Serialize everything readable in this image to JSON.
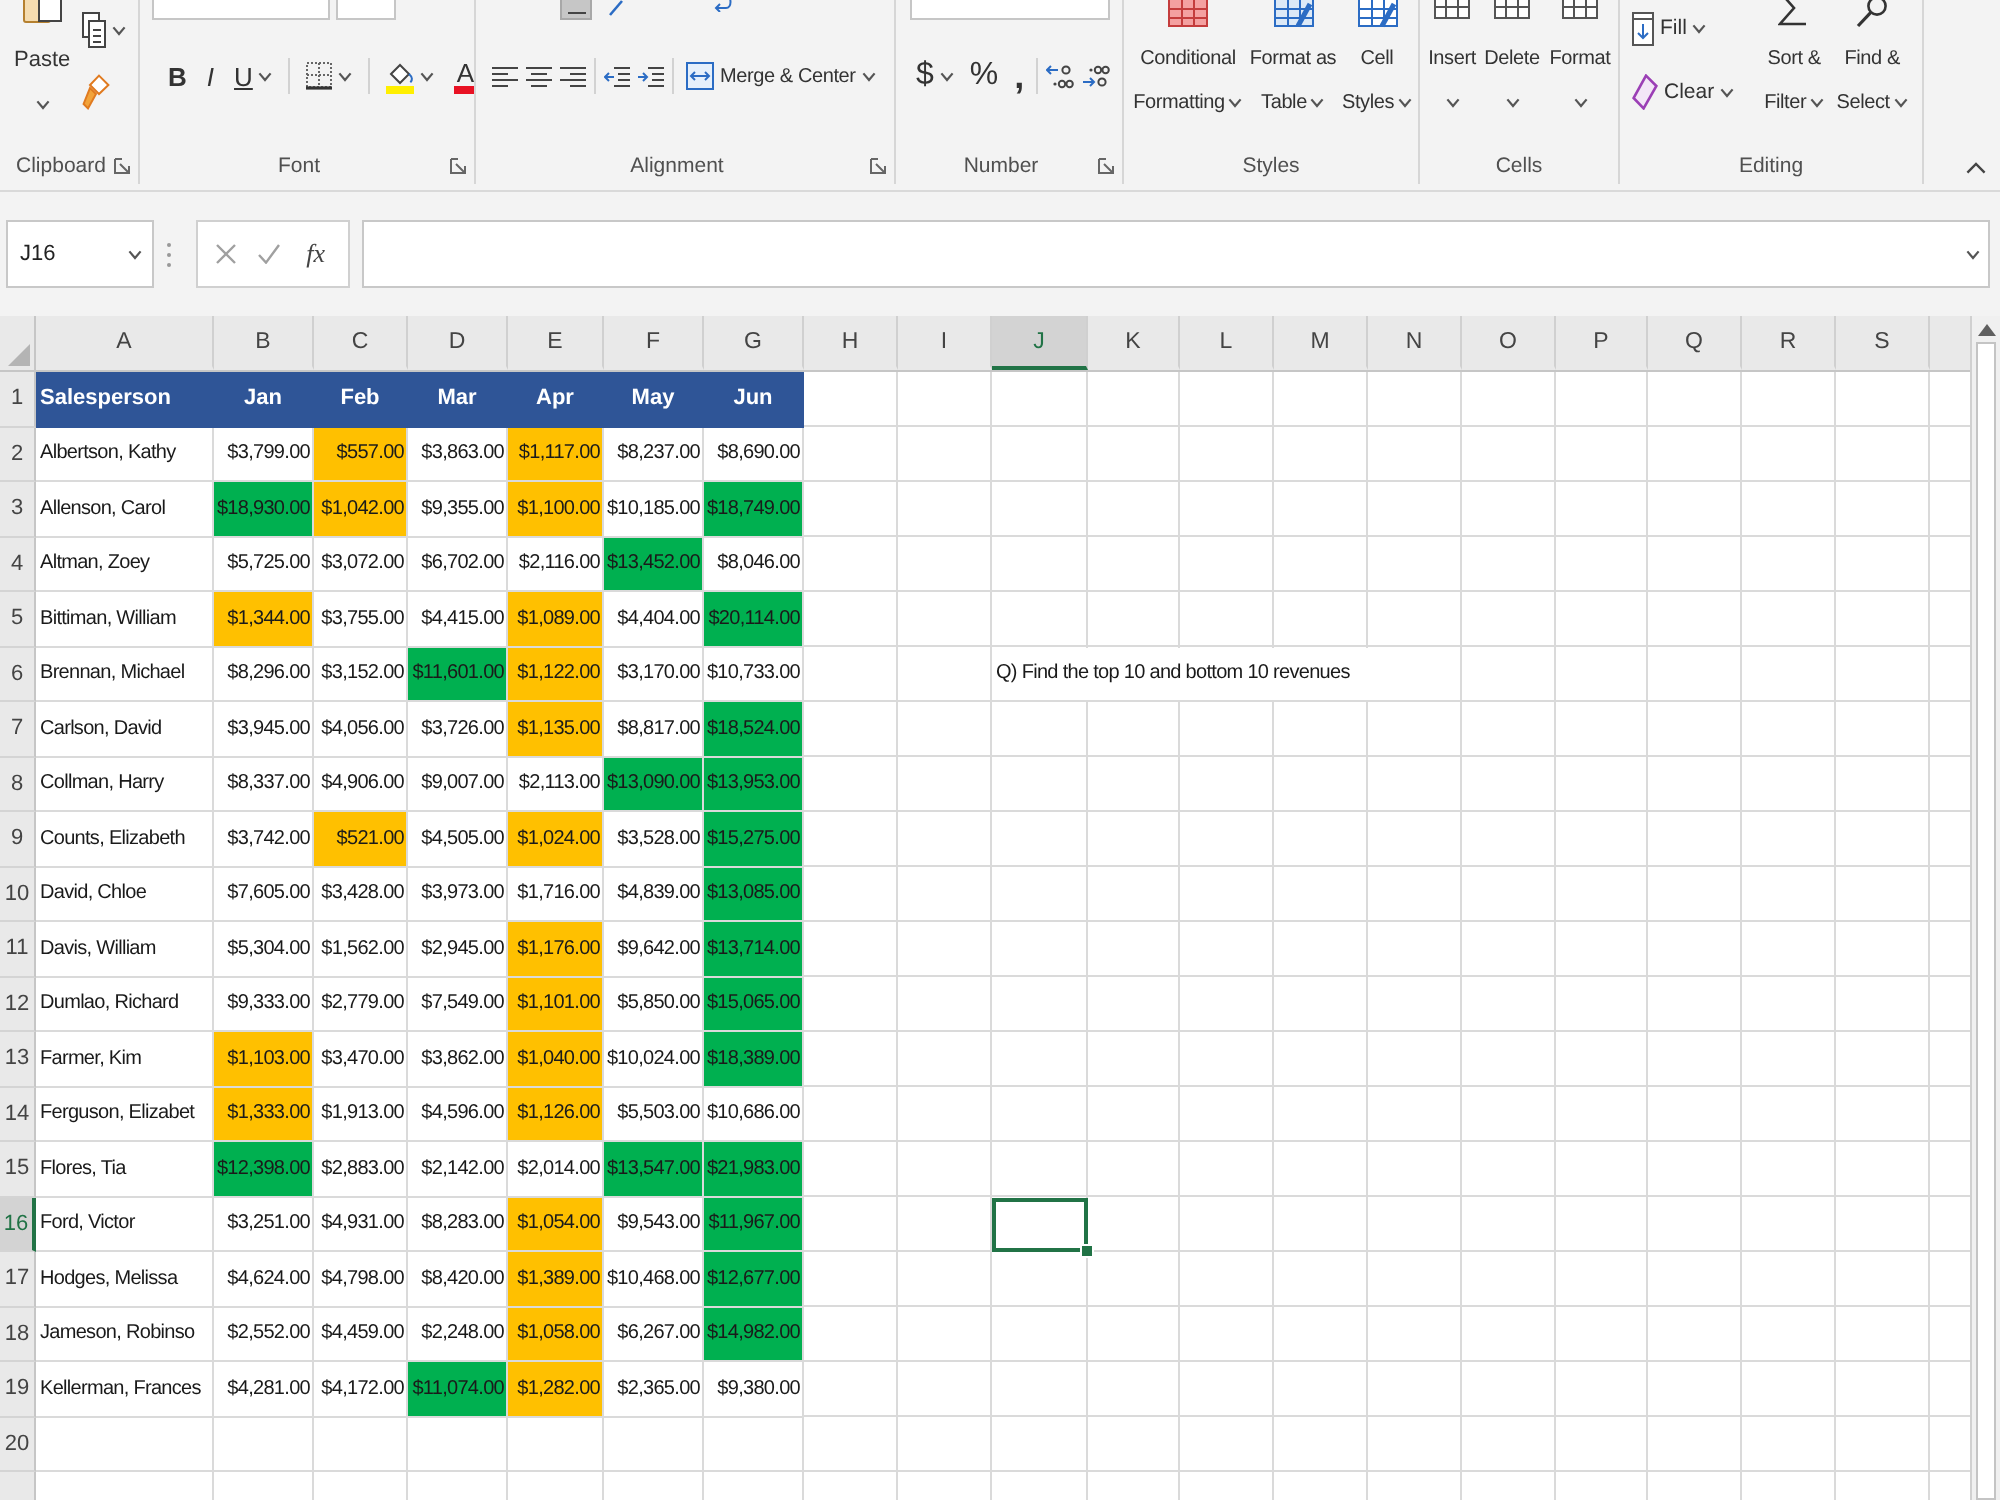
{
  "ribbon": {
    "groups": [
      {
        "kind": "clipboard",
        "label": "Clipboard",
        "launcher": true,
        "paste": "Paste"
      },
      {
        "kind": "font",
        "label": "Font",
        "launcher": true,
        "bold": "B",
        "italic": "I",
        "underline": "U",
        "font_color": "A"
      },
      {
        "kind": "alignment",
        "label": "Alignment",
        "launcher": true,
        "middle_align_selected": true,
        "merge": "Merge & Center"
      },
      {
        "kind": "number",
        "label": "Number",
        "launcher": true,
        "currency": "$",
        "percent": "%",
        "comma": ","
      },
      {
        "kind": "styles",
        "label": "Styles",
        "launcher": false,
        "buttons": [
          "Conditional Formatting",
          "Format as Table",
          "Cell Styles"
        ]
      },
      {
        "kind": "cells",
        "label": "Cells",
        "launcher": false,
        "buttons": [
          "Insert",
          "Delete",
          "Format"
        ]
      },
      {
        "kind": "editing",
        "label": "Editing",
        "launcher": false,
        "fill": "Fill",
        "clear": "Clear",
        "buttons": [
          "Sort & Filter",
          "Find & Select"
        ]
      }
    ]
  },
  "formula_bar": {
    "name_box": "J16",
    "function_button": "fx"
  },
  "sheet": {
    "columns": [
      {
        "label": "A",
        "selected": false
      },
      {
        "label": "B",
        "selected": false
      },
      {
        "label": "C",
        "selected": false
      },
      {
        "label": "D",
        "selected": false
      },
      {
        "label": "E",
        "selected": false
      },
      {
        "label": "F",
        "selected": false
      },
      {
        "label": "G",
        "selected": false
      },
      {
        "label": "H",
        "selected": false
      },
      {
        "label": "I",
        "selected": false
      },
      {
        "label": "J",
        "selected": true
      },
      {
        "label": "K",
        "selected": false
      },
      {
        "label": "L",
        "selected": false
      },
      {
        "label": "M",
        "selected": false
      },
      {
        "label": "N",
        "selected": false
      },
      {
        "label": "O",
        "selected": false
      },
      {
        "label": "P",
        "selected": false
      },
      {
        "label": "Q",
        "selected": false
      },
      {
        "label": "R",
        "selected": false
      },
      {
        "label": "S",
        "selected": false
      }
    ],
    "rows": [
      {
        "label": "1",
        "selected": false
      },
      {
        "label": "2",
        "selected": false
      },
      {
        "label": "3",
        "selected": false
      },
      {
        "label": "4",
        "selected": false
      },
      {
        "label": "5",
        "selected": false
      },
      {
        "label": "6",
        "selected": false
      },
      {
        "label": "7",
        "selected": false
      },
      {
        "label": "8",
        "selected": false
      },
      {
        "label": "9",
        "selected": false
      },
      {
        "label": "10",
        "selected": false
      },
      {
        "label": "11",
        "selected": false
      },
      {
        "label": "12",
        "selected": false
      },
      {
        "label": "13",
        "selected": false
      },
      {
        "label": "14",
        "selected": false
      },
      {
        "label": "15",
        "selected": false
      },
      {
        "label": "16",
        "selected": true
      },
      {
        "label": "17",
        "selected": false
      },
      {
        "label": "18",
        "selected": false
      },
      {
        "label": "19",
        "selected": false
      },
      {
        "label": "20",
        "selected": false
      }
    ],
    "header_row": [
      "Salesperson",
      "Jan",
      "Feb",
      "Mar",
      "Apr",
      "May",
      "Jun"
    ],
    "records": [
      {
        "name": "Albertson, Kathy",
        "cells": [
          {
            "value": "$3,799.00",
            "color": "#ffffff"
          },
          {
            "value": "$557.00",
            "color": "#ffc000"
          },
          {
            "value": "$3,863.00",
            "color": "#ffffff"
          },
          {
            "value": "$1,117.00",
            "color": "#ffc000"
          },
          {
            "value": "$8,237.00",
            "color": "#ffffff"
          },
          {
            "value": "$8,690.00",
            "color": "#ffffff"
          }
        ]
      },
      {
        "name": "Allenson, Carol",
        "cells": [
          {
            "value": "$18,930.00",
            "color": "#00b050"
          },
          {
            "value": "$1,042.00",
            "color": "#ffc000"
          },
          {
            "value": "$9,355.00",
            "color": "#ffffff"
          },
          {
            "value": "$1,100.00",
            "color": "#ffc000"
          },
          {
            "value": "$10,185.00",
            "color": "#ffffff"
          },
          {
            "value": "$18,749.00",
            "color": "#00b050"
          }
        ]
      },
      {
        "name": "Altman, Zoey",
        "cells": [
          {
            "value": "$5,725.00",
            "color": "#ffffff"
          },
          {
            "value": "$3,072.00",
            "color": "#ffffff"
          },
          {
            "value": "$6,702.00",
            "color": "#ffffff"
          },
          {
            "value": "$2,116.00",
            "color": "#ffffff"
          },
          {
            "value": "$13,452.00",
            "color": "#00b050"
          },
          {
            "value": "$8,046.00",
            "color": "#ffffff"
          }
        ]
      },
      {
        "name": "Bittiman, William",
        "cells": [
          {
            "value": "$1,344.00",
            "color": "#ffc000"
          },
          {
            "value": "$3,755.00",
            "color": "#ffffff"
          },
          {
            "value": "$4,415.00",
            "color": "#ffffff"
          },
          {
            "value": "$1,089.00",
            "color": "#ffc000"
          },
          {
            "value": "$4,404.00",
            "color": "#ffffff"
          },
          {
            "value": "$20,114.00",
            "color": "#00b050"
          }
        ]
      },
      {
        "name": "Brennan, Michael",
        "cells": [
          {
            "value": "$8,296.00",
            "color": "#ffffff"
          },
          {
            "value": "$3,152.00",
            "color": "#ffffff"
          },
          {
            "value": "$11,601.00",
            "color": "#00b050"
          },
          {
            "value": "$1,122.00",
            "color": "#ffc000"
          },
          {
            "value": "$3,170.00",
            "color": "#ffffff"
          },
          {
            "value": "$10,733.00",
            "color": "#ffffff"
          }
        ],
        "column_j": "Q) Find the top 10 and bottom 10 revenues"
      },
      {
        "name": "Carlson, David",
        "cells": [
          {
            "value": "$3,945.00",
            "color": "#ffffff"
          },
          {
            "value": "$4,056.00",
            "color": "#ffffff"
          },
          {
            "value": "$3,726.00",
            "color": "#ffffff"
          },
          {
            "value": "$1,135.00",
            "color": "#ffc000"
          },
          {
            "value": "$8,817.00",
            "color": "#ffffff"
          },
          {
            "value": "$18,524.00",
            "color": "#00b050"
          }
        ]
      },
      {
        "name": "Collman, Harry",
        "cells": [
          {
            "value": "$8,337.00",
            "color": "#ffffff"
          },
          {
            "value": "$4,906.00",
            "color": "#ffffff"
          },
          {
            "value": "$9,007.00",
            "color": "#ffffff"
          },
          {
            "value": "$2,113.00",
            "color": "#ffffff"
          },
          {
            "value": "$13,090.00",
            "color": "#00b050"
          },
          {
            "value": "$13,953.00",
            "color": "#00b050"
          }
        ]
      },
      {
        "name": "Counts, Elizabeth",
        "cells": [
          {
            "value": "$3,742.00",
            "color": "#ffffff"
          },
          {
            "value": "$521.00",
            "color": "#ffc000"
          },
          {
            "value": "$4,505.00",
            "color": "#ffffff"
          },
          {
            "value": "$1,024.00",
            "color": "#ffc000"
          },
          {
            "value": "$3,528.00",
            "color": "#ffffff"
          },
          {
            "value": "$15,275.00",
            "color": "#00b050"
          }
        ]
      },
      {
        "name": "David, Chloe",
        "cells": [
          {
            "value": "$7,605.00",
            "color": "#ffffff"
          },
          {
            "value": "$3,428.00",
            "color": "#ffffff"
          },
          {
            "value": "$3,973.00",
            "color": "#ffffff"
          },
          {
            "value": "$1,716.00",
            "color": "#ffffff"
          },
          {
            "value": "$4,839.00",
            "color": "#ffffff"
          },
          {
            "value": "$13,085.00",
            "color": "#00b050"
          }
        ]
      },
      {
        "name": "Davis, William",
        "cells": [
          {
            "value": "$5,304.00",
            "color": "#ffffff"
          },
          {
            "value": "$1,562.00",
            "color": "#ffffff"
          },
          {
            "value": "$2,945.00",
            "color": "#ffffff"
          },
          {
            "value": "$1,176.00",
            "color": "#ffc000"
          },
          {
            "value": "$9,642.00",
            "color": "#ffffff"
          },
          {
            "value": "$13,714.00",
            "color": "#00b050"
          }
        ]
      },
      {
        "name": "Dumlao, Richard",
        "cells": [
          {
            "value": "$9,333.00",
            "color": "#ffffff"
          },
          {
            "value": "$2,779.00",
            "color": "#ffffff"
          },
          {
            "value": "$7,549.00",
            "color": "#ffffff"
          },
          {
            "value": "$1,101.00",
            "color": "#ffc000"
          },
          {
            "value": "$5,850.00",
            "color": "#ffffff"
          },
          {
            "value": "$15,065.00",
            "color": "#00b050"
          }
        ]
      },
      {
        "name": "Farmer, Kim",
        "cells": [
          {
            "value": "$1,103.00",
            "color": "#ffc000"
          },
          {
            "value": "$3,470.00",
            "color": "#ffffff"
          },
          {
            "value": "$3,862.00",
            "color": "#ffffff"
          },
          {
            "value": "$1,040.00",
            "color": "#ffc000"
          },
          {
            "value": "$10,024.00",
            "color": "#ffffff"
          },
          {
            "value": "$18,389.00",
            "color": "#00b050"
          }
        ]
      },
      {
        "name": "Ferguson, Elizabet",
        "cells": [
          {
            "value": "$1,333.00",
            "color": "#ffc000"
          },
          {
            "value": "$1,913.00",
            "color": "#ffffff"
          },
          {
            "value": "$4,596.00",
            "color": "#ffffff"
          },
          {
            "value": "$1,126.00",
            "color": "#ffc000"
          },
          {
            "value": "$5,503.00",
            "color": "#ffffff"
          },
          {
            "value": "$10,686.00",
            "color": "#ffffff"
          }
        ]
      },
      {
        "name": "Flores, Tia",
        "cells": [
          {
            "value": "$12,398.00",
            "color": "#00b050"
          },
          {
            "value": "$2,883.00",
            "color": "#ffffff"
          },
          {
            "value": "$2,142.00",
            "color": "#ffffff"
          },
          {
            "value": "$2,014.00",
            "color": "#ffffff"
          },
          {
            "value": "$13,547.00",
            "color": "#00b050"
          },
          {
            "value": "$21,983.00",
            "color": "#00b050"
          }
        ]
      },
      {
        "name": "Ford, Victor",
        "cells": [
          {
            "value": "$3,251.00",
            "color": "#ffffff"
          },
          {
            "value": "$4,931.00",
            "color": "#ffffff"
          },
          {
            "value": "$8,283.00",
            "color": "#ffffff"
          },
          {
            "value": "$1,054.00",
            "color": "#ffc000"
          },
          {
            "value": "$9,543.00",
            "color": "#ffffff"
          },
          {
            "value": "$11,967.00",
            "color": "#00b050"
          }
        ]
      },
      {
        "name": "Hodges, Melissa",
        "cells": [
          {
            "value": "$4,624.00",
            "color": "#ffffff"
          },
          {
            "value": "$4,798.00",
            "color": "#ffffff"
          },
          {
            "value": "$8,420.00",
            "color": "#ffffff"
          },
          {
            "value": "$1,389.00",
            "color": "#ffc000"
          },
          {
            "value": "$10,468.00",
            "color": "#ffffff"
          },
          {
            "value": "$12,677.00",
            "color": "#00b050"
          }
        ]
      },
      {
        "name": "Jameson, Robinso",
        "cells": [
          {
            "value": "$2,552.00",
            "color": "#ffffff"
          },
          {
            "value": "$4,459.00",
            "color": "#ffffff"
          },
          {
            "value": "$2,248.00",
            "color": "#ffffff"
          },
          {
            "value": "$1,058.00",
            "color": "#ffc000"
          },
          {
            "value": "$6,267.00",
            "color": "#ffffff"
          },
          {
            "value": "$14,982.00",
            "color": "#00b050"
          }
        ]
      },
      {
        "name": "Kellerman, Frances",
        "cells": [
          {
            "value": "$4,281.00",
            "color": "#ffffff"
          },
          {
            "value": "$4,172.00",
            "color": "#ffffff"
          },
          {
            "value": "$11,074.00",
            "color": "#00b050"
          },
          {
            "value": "$1,282.00",
            "color": "#ffc000"
          },
          {
            "value": "$2,365.00",
            "color": "#ffffff"
          },
          {
            "value": "$9,380.00",
            "color": "#ffffff"
          }
        ]
      }
    ]
  }
}
